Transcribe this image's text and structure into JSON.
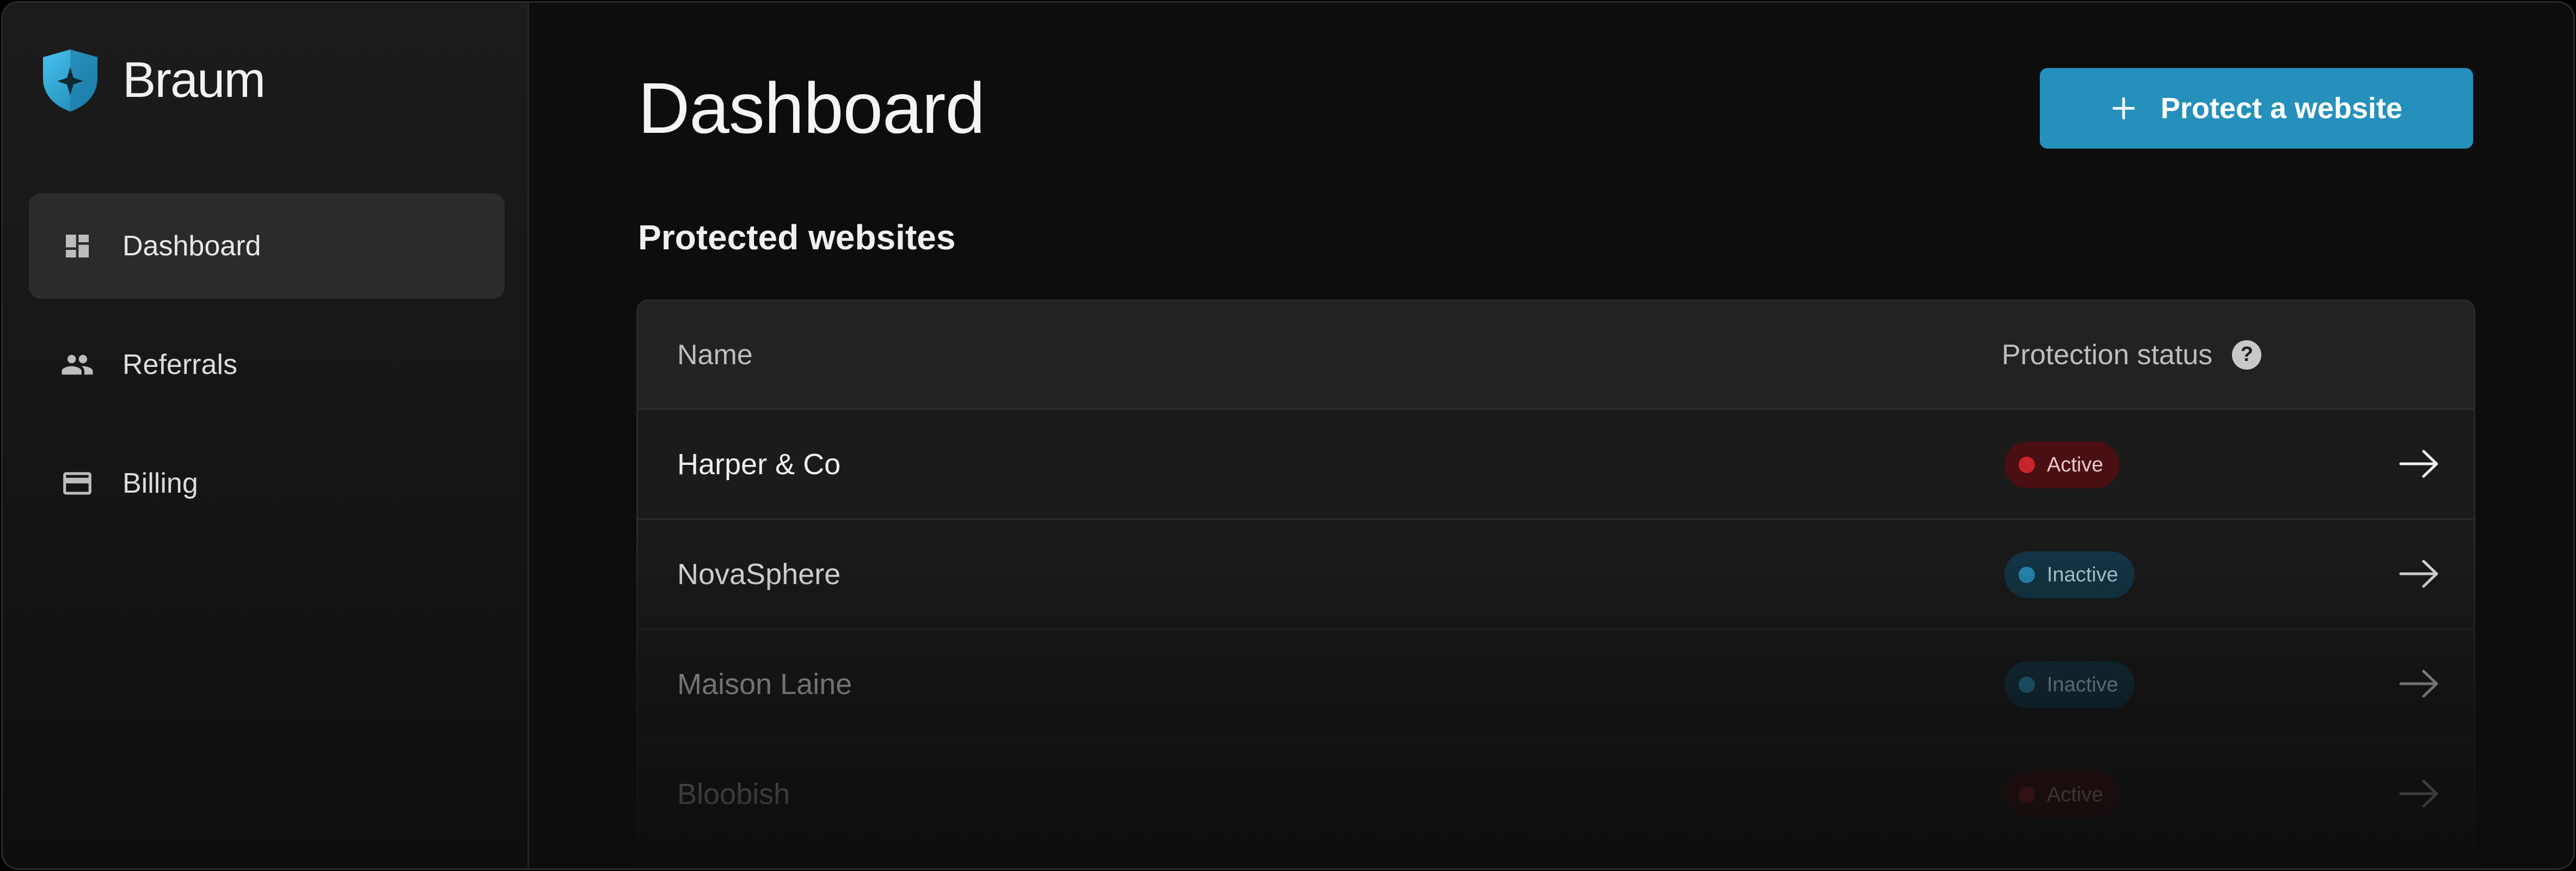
{
  "app": {
    "brand_name": "Braum",
    "brand_logo_icon": "shield-star-icon",
    "accent_color": "#2690bd"
  },
  "sidebar": {
    "items": [
      {
        "label": "Dashboard",
        "icon": "dashboard-grid-icon",
        "active": true
      },
      {
        "label": "Referrals",
        "icon": "people-icon",
        "active": false
      },
      {
        "label": "Billing",
        "icon": "credit-card-icon",
        "active": false
      }
    ]
  },
  "header": {
    "title": "Dashboard",
    "primary_button": {
      "icon": "plus-icon",
      "label": "Protect a website"
    }
  },
  "websites": {
    "section_title": "Protected websites",
    "columns": {
      "name": "Name",
      "status": "Protection status",
      "help_icon": "question-mark-icon",
      "help_glyph": "?"
    },
    "rows": [
      {
        "name": "Harper & Co",
        "status": "Active",
        "status_color": "#c9242c"
      },
      {
        "name": "NovaSphere",
        "status": "Inactive",
        "status_color": "#2a92c0"
      },
      {
        "name": "Maison Laine",
        "status": "Inactive",
        "status_color": "#2a92c0"
      },
      {
        "name": "Bloobish",
        "status": "Active",
        "status_color": "#c9242c"
      }
    ]
  }
}
